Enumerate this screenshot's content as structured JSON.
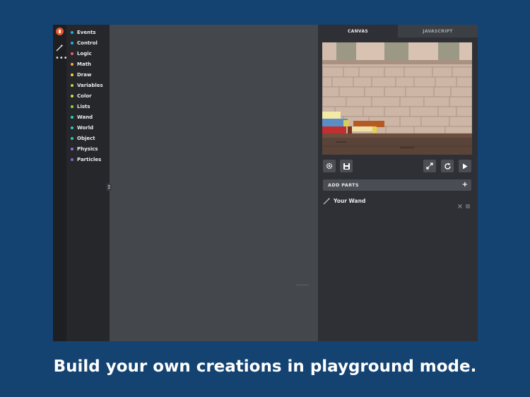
{
  "caption": "Build your own creations in playground mode.",
  "categories": [
    {
      "label": "Events",
      "color": "#1fb3e0"
    },
    {
      "label": "Control",
      "color": "#1fb3e0"
    },
    {
      "label": "Logic",
      "color": "#e85d75"
    },
    {
      "label": "Math",
      "color": "#f2a93b"
    },
    {
      "label": "Draw",
      "color": "#f2d13b"
    },
    {
      "label": "Variables",
      "color": "#b6d84a"
    },
    {
      "label": "Color",
      "color": "#d6e04a"
    },
    {
      "label": "Lists",
      "color": "#8ed84a"
    },
    {
      "label": "Wand",
      "color": "#2ecfc2"
    },
    {
      "label": "World",
      "color": "#2ec7c7"
    },
    {
      "label": "Object",
      "color": "#2ec7b0"
    },
    {
      "label": "Physics",
      "color": "#9a6bd8"
    },
    {
      "label": "Particles",
      "color": "#8a63d0"
    }
  ],
  "tabs": {
    "canvas": "CANVAS",
    "javascript": "JAVASCRIPT",
    "active": "canvas"
  },
  "add_parts": {
    "label": "ADD PARTS",
    "plus": "+"
  },
  "parts": [
    {
      "label": "Your Wand"
    }
  ],
  "icons": {
    "logo": "flame-icon",
    "wand_tool": "wand-icon",
    "more_tool": "more-icon",
    "recenter": "crosshair-icon",
    "zoom_in": "plus-icon",
    "zoom_out": "minus-icon",
    "trash": "trash-icon",
    "settings": "gear-icon",
    "save": "floppy-icon",
    "fullscreen": "expand-icon",
    "reset": "refresh-icon",
    "play": "play-icon"
  },
  "colors": {
    "background": "#144372",
    "accent": "#e8582a"
  }
}
